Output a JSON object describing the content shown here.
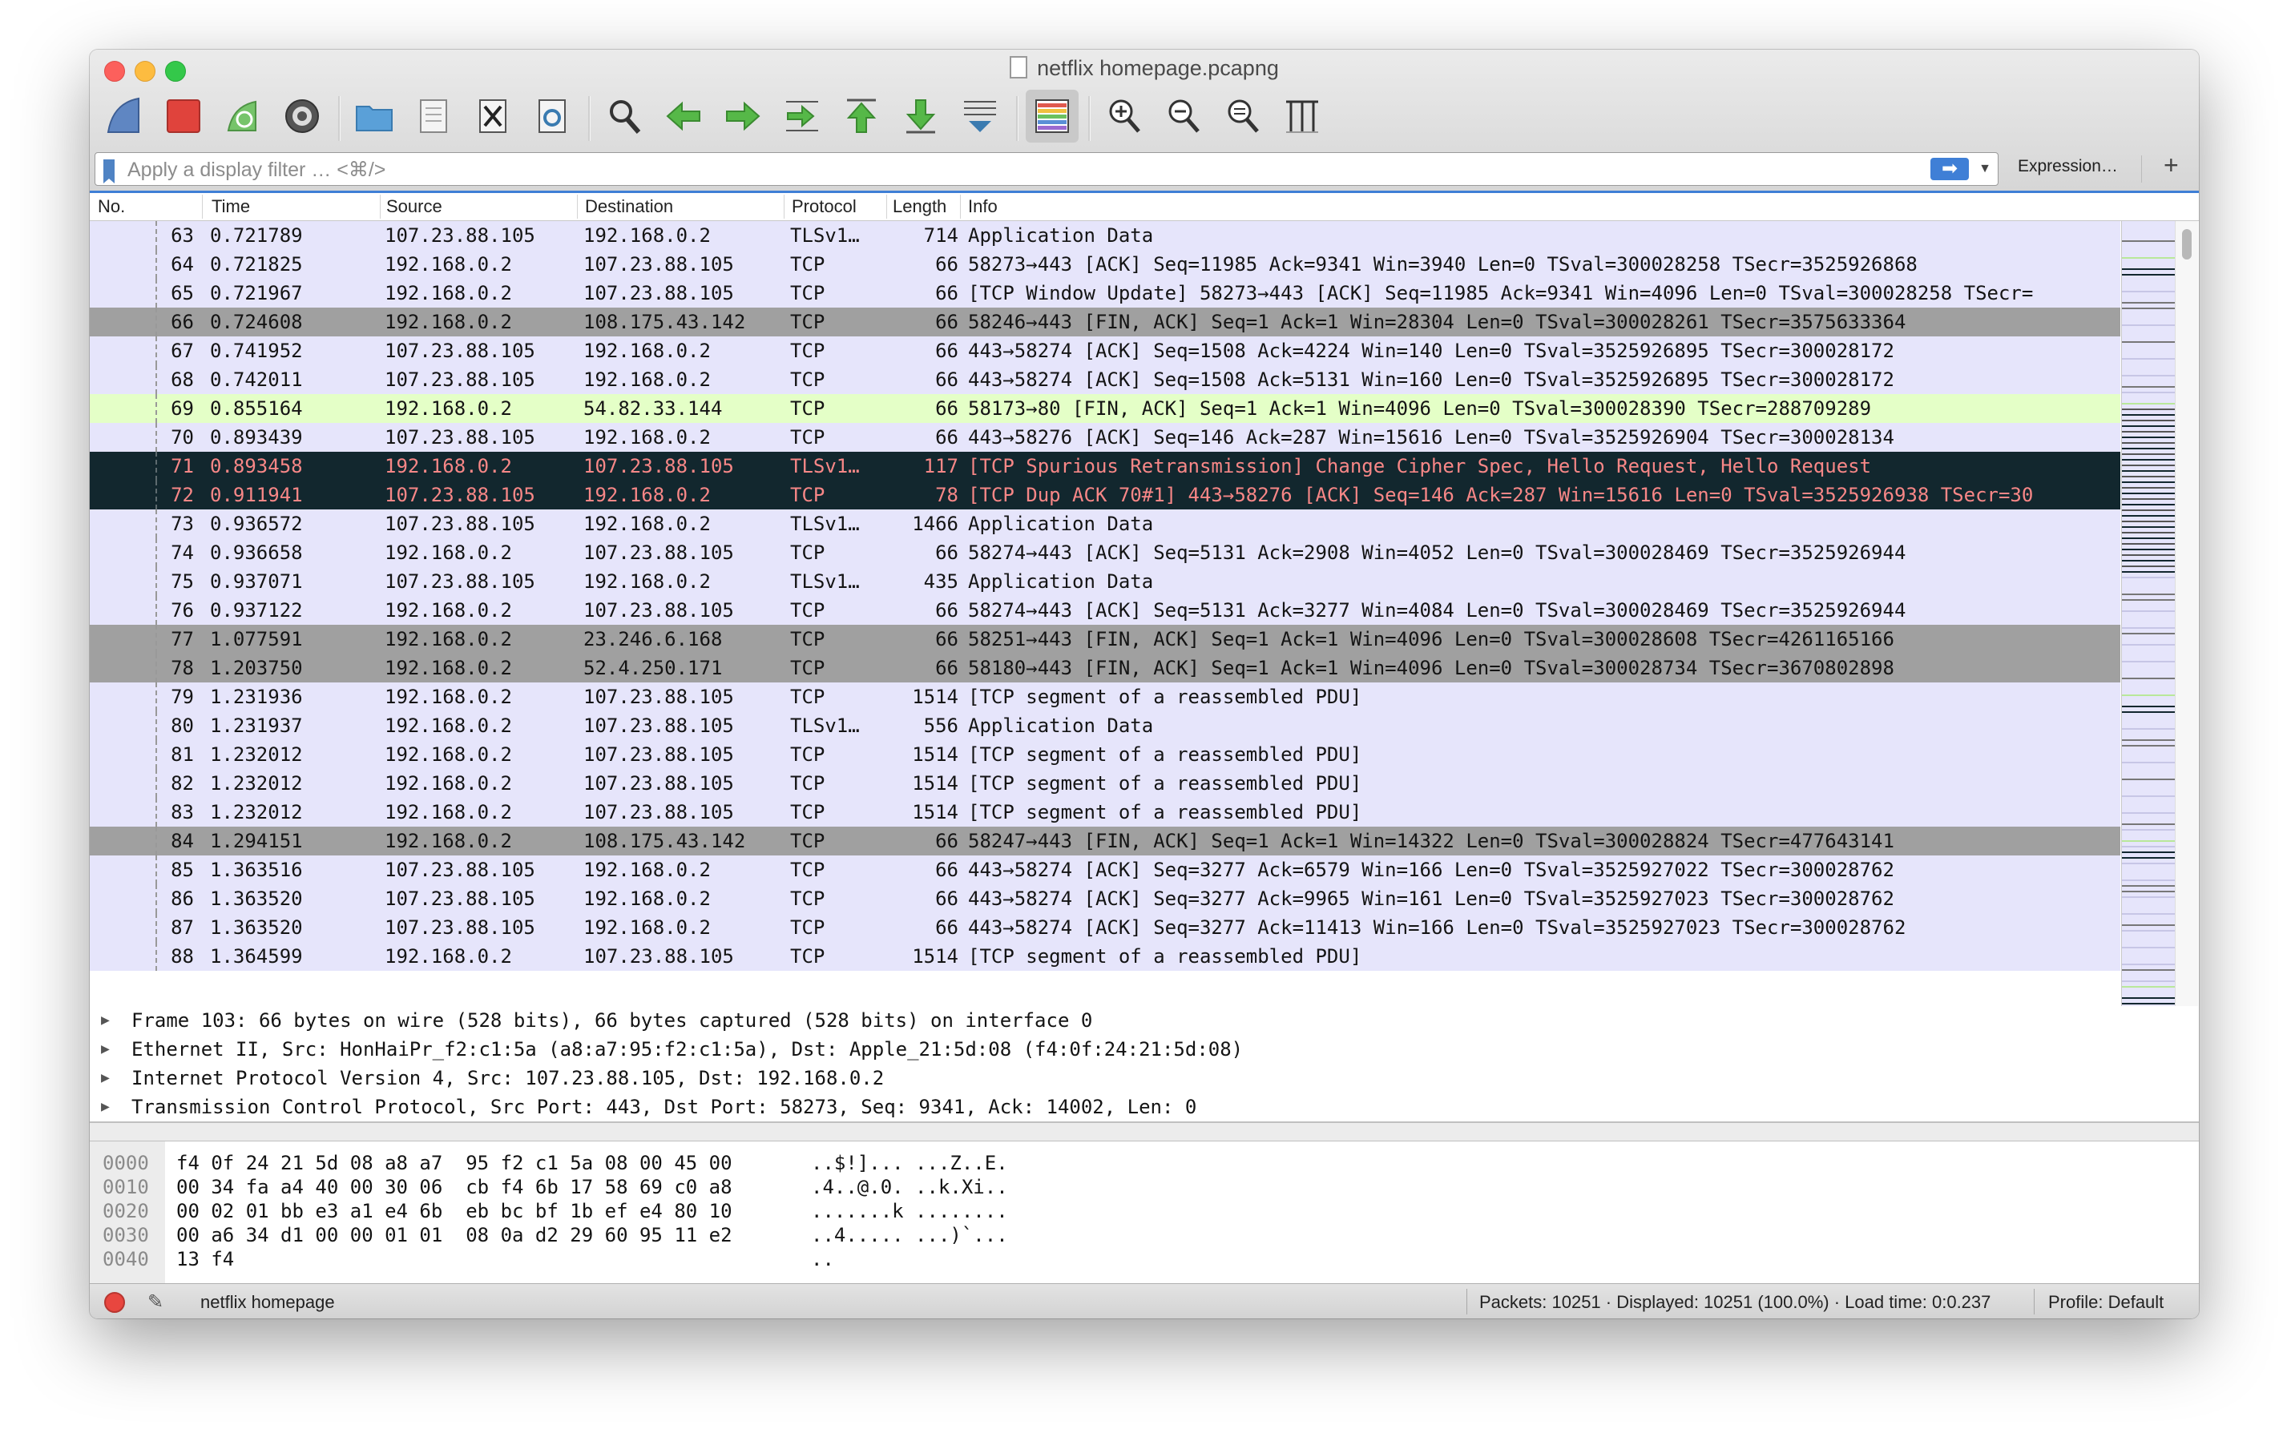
{
  "window": {
    "title": "netflix homepage.pcapng"
  },
  "toolbar": {
    "buttons": [
      "start-capture-icon",
      "stop-capture-icon",
      "restart-capture-icon",
      "capture-options-icon",
      "open-file-icon",
      "recent-file-icon",
      "close-file-icon",
      "reload-file-icon",
      "find-packet-icon",
      "go-back-icon",
      "go-forward-icon",
      "go-to-packet-icon",
      "go-first-icon",
      "go-last-icon",
      "autoscroll-icon",
      "colorize-icon",
      "zoom-in-icon",
      "zoom-out-icon",
      "normal-size-icon",
      "resize-columns-icon"
    ]
  },
  "filter": {
    "placeholder": "Apply a display filter … <⌘/>",
    "apply_glyph": "➡",
    "expression_label": "Expression…",
    "add_label": "+"
  },
  "columns": [
    "No.",
    "Time",
    "Source",
    "Destination",
    "Protocol",
    "Length",
    "Info"
  ],
  "colors": {
    "default": "#e6e5fb",
    "gray": "#a0a0a0",
    "green": "#e4ffc7",
    "black": "#12272e",
    "black_text": "#f78787",
    "accent": "#3f7fd6"
  },
  "packets": [
    {
      "no": "63",
      "time": "0.721789",
      "src": "107.23.88.105",
      "dst": "192.168.0.2",
      "proto": "TLSv1…",
      "len": "714",
      "info": "Application Data",
      "style": "default"
    },
    {
      "no": "64",
      "time": "0.721825",
      "src": "192.168.0.2",
      "dst": "107.23.88.105",
      "proto": "TCP",
      "len": "66",
      "info": "58273→443 [ACK] Seq=11985 Ack=9341 Win=3940 Len=0 TSval=300028258 TSecr=3525926868",
      "style": "default"
    },
    {
      "no": "65",
      "time": "0.721967",
      "src": "192.168.0.2",
      "dst": "107.23.88.105",
      "proto": "TCP",
      "len": "66",
      "info": "[TCP Window Update] 58273→443 [ACK] Seq=11985 Ack=9341 Win=4096 Len=0 TSval=300028258 TSecr=",
      "style": "default"
    },
    {
      "no": "66",
      "time": "0.724608",
      "src": "192.168.0.2",
      "dst": "108.175.43.142",
      "proto": "TCP",
      "len": "66",
      "info": "58246→443 [FIN, ACK] Seq=1 Ack=1 Win=28304 Len=0 TSval=300028261 TSecr=3575633364",
      "style": "gray"
    },
    {
      "no": "67",
      "time": "0.741952",
      "src": "107.23.88.105",
      "dst": "192.168.0.2",
      "proto": "TCP",
      "len": "66",
      "info": "443→58274 [ACK] Seq=1508 Ack=4224 Win=140 Len=0 TSval=3525926895 TSecr=300028172",
      "style": "default"
    },
    {
      "no": "68",
      "time": "0.742011",
      "src": "107.23.88.105",
      "dst": "192.168.0.2",
      "proto": "TCP",
      "len": "66",
      "info": "443→58274 [ACK] Seq=1508 Ack=5131 Win=160 Len=0 TSval=3525926895 TSecr=300028172",
      "style": "default"
    },
    {
      "no": "69",
      "time": "0.855164",
      "src": "192.168.0.2",
      "dst": "54.82.33.144",
      "proto": "TCP",
      "len": "66",
      "info": "58173→80 [FIN, ACK] Seq=1 Ack=1 Win=4096 Len=0 TSval=300028390 TSecr=288709289",
      "style": "green"
    },
    {
      "no": "70",
      "time": "0.893439",
      "src": "107.23.88.105",
      "dst": "192.168.0.2",
      "proto": "TCP",
      "len": "66",
      "info": "443→58276 [ACK] Seq=146 Ack=287 Win=15616 Len=0 TSval=3525926904 TSecr=300028134",
      "style": "default"
    },
    {
      "no": "71",
      "time": "0.893458",
      "src": "192.168.0.2",
      "dst": "107.23.88.105",
      "proto": "TLSv1…",
      "len": "117",
      "info": "[TCP Spurious Retransmission] Change Cipher Spec, Hello Request, Hello Request",
      "style": "black"
    },
    {
      "no": "72",
      "time": "0.911941",
      "src": "107.23.88.105",
      "dst": "192.168.0.2",
      "proto": "TCP",
      "len": "78",
      "info": "[TCP Dup ACK 70#1] 443→58276 [ACK] Seq=146 Ack=287 Win=15616 Len=0 TSval=3525926938 TSecr=30",
      "style": "black"
    },
    {
      "no": "73",
      "time": "0.936572",
      "src": "107.23.88.105",
      "dst": "192.168.0.2",
      "proto": "TLSv1…",
      "len": "1466",
      "info": "Application Data",
      "style": "default"
    },
    {
      "no": "74",
      "time": "0.936658",
      "src": "192.168.0.2",
      "dst": "107.23.88.105",
      "proto": "TCP",
      "len": "66",
      "info": "58274→443 [ACK] Seq=5131 Ack=2908 Win=4052 Len=0 TSval=300028469 TSecr=3525926944",
      "style": "default"
    },
    {
      "no": "75",
      "time": "0.937071",
      "src": "107.23.88.105",
      "dst": "192.168.0.2",
      "proto": "TLSv1…",
      "len": "435",
      "info": "Application Data",
      "style": "default"
    },
    {
      "no": "76",
      "time": "0.937122",
      "src": "192.168.0.2",
      "dst": "107.23.88.105",
      "proto": "TCP",
      "len": "66",
      "info": "58274→443 [ACK] Seq=5131 Ack=3277 Win=4084 Len=0 TSval=300028469 TSecr=3525926944",
      "style": "default"
    },
    {
      "no": "77",
      "time": "1.077591",
      "src": "192.168.0.2",
      "dst": "23.246.6.168",
      "proto": "TCP",
      "len": "66",
      "info": "58251→443 [FIN, ACK] Seq=1 Ack=1 Win=4096 Len=0 TSval=300028608 TSecr=4261165166",
      "style": "gray"
    },
    {
      "no": "78",
      "time": "1.203750",
      "src": "192.168.0.2",
      "dst": "52.4.250.171",
      "proto": "TCP",
      "len": "66",
      "info": "58180→443 [FIN, ACK] Seq=1 Ack=1 Win=4096 Len=0 TSval=300028734 TSecr=3670802898",
      "style": "gray"
    },
    {
      "no": "79",
      "time": "1.231936",
      "src": "192.168.0.2",
      "dst": "107.23.88.105",
      "proto": "TCP",
      "len": "1514",
      "info": "[TCP segment of a reassembled PDU]",
      "style": "default"
    },
    {
      "no": "80",
      "time": "1.231937",
      "src": "192.168.0.2",
      "dst": "107.23.88.105",
      "proto": "TLSv1…",
      "len": "556",
      "info": "Application Data",
      "style": "default"
    },
    {
      "no": "81",
      "time": "1.232012",
      "src": "192.168.0.2",
      "dst": "107.23.88.105",
      "proto": "TCP",
      "len": "1514",
      "info": "[TCP segment of a reassembled PDU]",
      "style": "default"
    },
    {
      "no": "82",
      "time": "1.232012",
      "src": "192.168.0.2",
      "dst": "107.23.88.105",
      "proto": "TCP",
      "len": "1514",
      "info": "[TCP segment of a reassembled PDU]",
      "style": "default"
    },
    {
      "no": "83",
      "time": "1.232012",
      "src": "192.168.0.2",
      "dst": "107.23.88.105",
      "proto": "TCP",
      "len": "1514",
      "info": "[TCP segment of a reassembled PDU]",
      "style": "default"
    },
    {
      "no": "84",
      "time": "1.294151",
      "src": "192.168.0.2",
      "dst": "108.175.43.142",
      "proto": "TCP",
      "len": "66",
      "info": "58247→443 [FIN, ACK] Seq=1 Ack=1 Win=14322 Len=0 TSval=300028824 TSecr=477643141",
      "style": "gray"
    },
    {
      "no": "85",
      "time": "1.363516",
      "src": "107.23.88.105",
      "dst": "192.168.0.2",
      "proto": "TCP",
      "len": "66",
      "info": "443→58274 [ACK] Seq=3277 Ack=6579 Win=166 Len=0 TSval=3525927022 TSecr=300028762",
      "style": "default"
    },
    {
      "no": "86",
      "time": "1.363520",
      "src": "107.23.88.105",
      "dst": "192.168.0.2",
      "proto": "TCP",
      "len": "66",
      "info": "443→58274 [ACK] Seq=3277 Ack=9965 Win=161 Len=0 TSval=3525927023 TSecr=300028762",
      "style": "default"
    },
    {
      "no": "87",
      "time": "1.363520",
      "src": "107.23.88.105",
      "dst": "192.168.0.2",
      "proto": "TCP",
      "len": "66",
      "info": "443→58274 [ACK] Seq=3277 Ack=11413 Win=166 Len=0 TSval=3525927023 TSecr=300028762",
      "style": "default"
    },
    {
      "no": "88",
      "time": "1.364599",
      "src": "192.168.0.2",
      "dst": "107.23.88.105",
      "proto": "TCP",
      "len": "1514",
      "info": "[TCP segment of a reassembled PDU]",
      "style": "default"
    }
  ],
  "details": [
    "Frame 103: 66 bytes on wire (528 bits), 66 bytes captured (528 bits) on interface 0",
    "Ethernet II, Src: HonHaiPr_f2:c1:5a (a8:a7:95:f2:c1:5a), Dst: Apple_21:5d:08 (f4:0f:24:21:5d:08)",
    "Internet Protocol Version 4, Src: 107.23.88.105, Dst: 192.168.0.2",
    "Transmission Control Protocol, Src Port: 443, Dst Port: 58273, Seq: 9341, Ack: 14002, Len: 0"
  ],
  "bytes": [
    {
      "offset": "0000",
      "hex": "f4 0f 24 21 5d 08 a8 a7  95 f2 c1 5a 08 00 45 00",
      "ascii": "..$!]... ...Z..E."
    },
    {
      "offset": "0010",
      "hex": "00 34 fa a4 40 00 30 06  cb f4 6b 17 58 69 c0 a8",
      "ascii": ".4..@.0. ..k.Xi.."
    },
    {
      "offset": "0020",
      "hex": "00 02 01 bb e3 a1 e4 6b  eb bc bf 1b ef e4 80 10",
      "ascii": ".......k ........"
    },
    {
      "offset": "0030",
      "hex": "00 a6 34 d1 00 00 01 01  08 0a d2 29 60 95 11 e2",
      "ascii": "..4..... ...)`..."
    },
    {
      "offset": "0040",
      "hex": "13 f4",
      "ascii": ".."
    }
  ],
  "status": {
    "file": "netflix homepage",
    "packets": "Packets: 10251 · Displayed: 10251 (100.0%) · Load time: 0:0.237",
    "profile": "Profile: Default"
  }
}
